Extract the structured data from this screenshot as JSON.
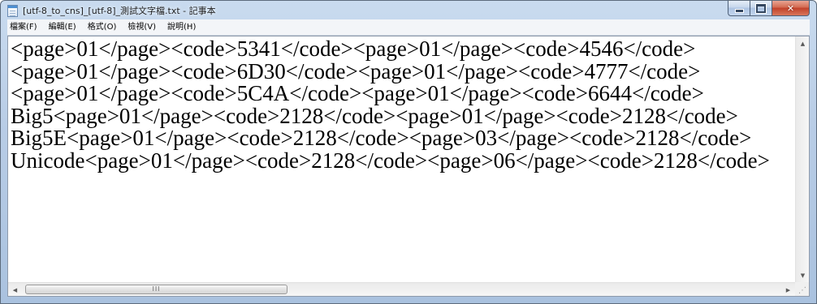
{
  "window": {
    "title": "[utf-8_to_cns]_[utf-8]_測試文字檔.txt - 記事本",
    "buttons": {
      "minimize_icon": "minimize-icon",
      "maximize_icon": "maximize-icon",
      "close_glyph": "✕"
    }
  },
  "menu": {
    "items": [
      {
        "label": "檔案(F)"
      },
      {
        "label": "編輯(E)"
      },
      {
        "label": "格式(O)"
      },
      {
        "label": "檢視(V)"
      },
      {
        "label": "說明(H)"
      }
    ]
  },
  "document": {
    "lines": [
      "<page>01</page><code>5341</code><page>01</page><code>4546</code>",
      "<page>01</page><code>6D30</code><page>01</page><code>4777</code>",
      "<page>01</page><code>5C4A</code><page>01</page><code>6644</code>",
      "Big5<page>01</page><code>2128</code><page>01</page><code>2128</code>",
      "Big5E<page>01</page><code>2128</code><page>03</page><code>2128</code>",
      "Unicode<page>01</page><code>2128</code><page>06</page><code>2128</code>"
    ]
  },
  "scrollbars": {
    "up_glyph": "▲",
    "down_glyph": "▼",
    "left_glyph": "◀",
    "right_glyph": "▶",
    "thumb_grip": "III"
  },
  "colors": {
    "titlebar": "#b9cde6",
    "close_button": "#c1412a",
    "menubar": "#f3f5f8",
    "editor_background": "#ffffff"
  }
}
